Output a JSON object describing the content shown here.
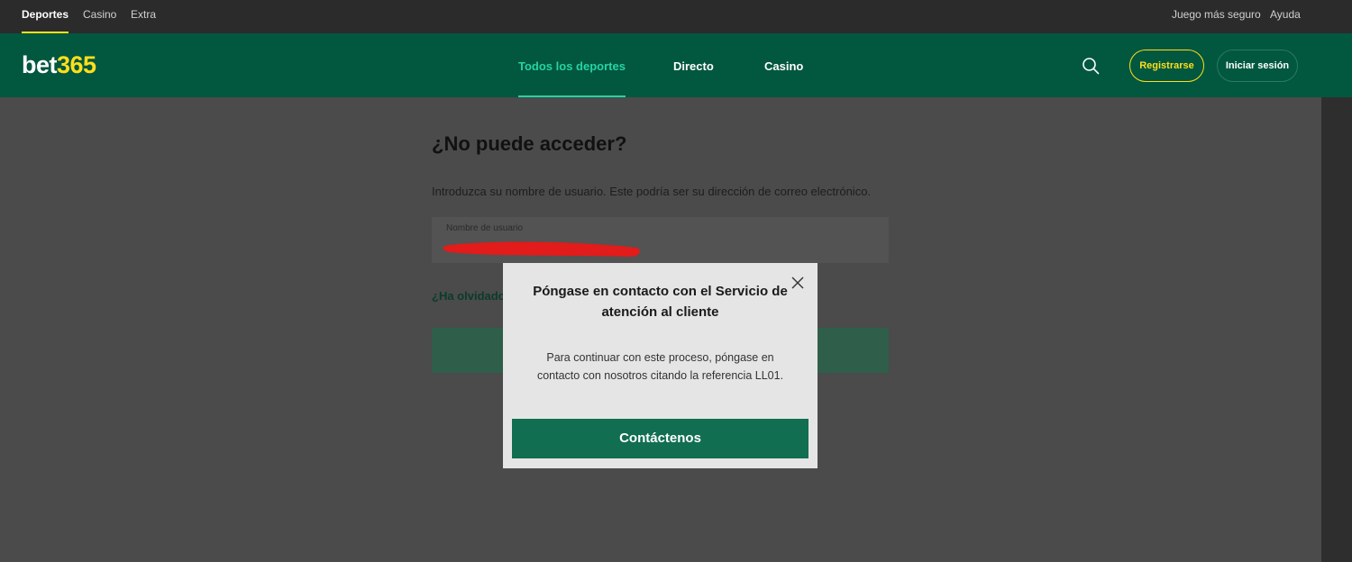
{
  "topbar": {
    "left": [
      "Deportes",
      "Casino",
      "Extra"
    ],
    "right": [
      "Juego más seguro",
      "Ayuda"
    ]
  },
  "header": {
    "logo": {
      "part1": "bet",
      "part2": "365"
    },
    "nav": [
      "Todos los deportes",
      "Directo",
      "Casino"
    ],
    "search_icon": "search-icon",
    "register_label": "Registrarse",
    "login_label": "Iniciar sesión"
  },
  "form": {
    "title": "¿No puede acceder?",
    "description": "Introduzca su nombre de usuario. Este podría ser su dirección de correo electrónico.",
    "username_label": "Nombre de usuario",
    "forgot_link": "¿Ha olvidado"
  },
  "modal": {
    "title": "Póngase en contacto con el Servicio de atención al cliente",
    "body": "Para continuar con este proceso, póngase en contacto con nosotros citando la referencia LL01.",
    "button_label": "Contáctenos",
    "close_icon": "close-icon"
  },
  "colors": {
    "brand_green": "#02573f",
    "accent_yellow": "#ffdf1b",
    "active_nav": "#26d3a3",
    "button_green": "#126e51"
  }
}
